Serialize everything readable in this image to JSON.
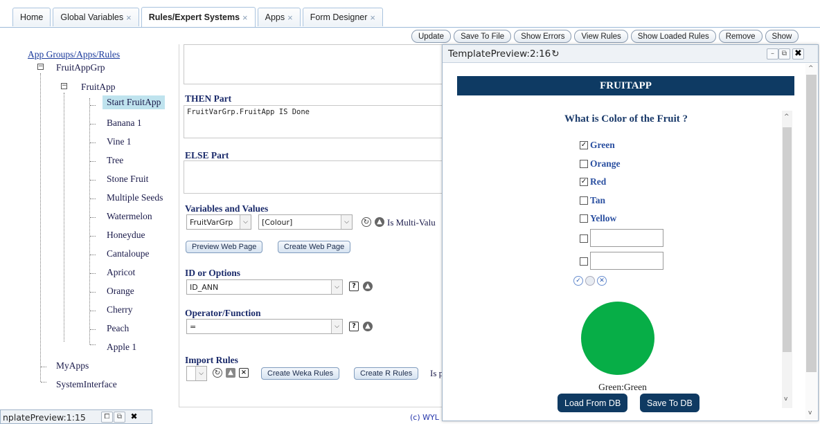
{
  "tabs": [
    {
      "label": "Home",
      "closable": false
    },
    {
      "label": "Global Variables",
      "closable": true
    },
    {
      "label": "Rules/Expert Systems",
      "closable": true
    },
    {
      "label": "Apps",
      "closable": true
    },
    {
      "label": "Form Designer",
      "closable": true
    }
  ],
  "toolbar": [
    "Update",
    "Save To File",
    "Show Errors",
    "View Rules",
    "Show Loaded Rules",
    "Remove",
    "Show"
  ],
  "tree": {
    "root": "App Groups/Apps/Rules",
    "group": "FruitAppGrp",
    "app": "FruitApp",
    "rules": [
      "Start FruitApp",
      "Banana 1",
      "Vine 1",
      "Tree",
      "Stone Fruit",
      "Multiple Seeds",
      "Watermelon",
      "Honeydue",
      "Cantaloupe",
      "Apricot",
      "Orange",
      "Cherry",
      "Peach",
      "Apple 1"
    ],
    "other_groups": [
      "MyApps",
      "SystemInterface"
    ]
  },
  "editor": {
    "then_label": "THEN Part",
    "then_value": "FruitVarGrp.FruitApp IS Done",
    "else_label": "ELSE Part",
    "vars_label": "Variables and Values",
    "var_group": "FruitVarGrp",
    "var_name": "[Colour]",
    "multi_value": "Is Multi-Valu",
    "preview_btn": "Preview Web Page",
    "create_btn": "Create Web Page",
    "id_label": "ID or Options",
    "id_value": "ID_ANN",
    "op_label": "Operator/Function",
    "op_value": "=",
    "import_label": "Import Rules",
    "weka_btn": "Create Weka Rules",
    "r_btn": "Create R Rules",
    "trailing": "Is p"
  },
  "preview": {
    "title": "TemplatePreview:2:16",
    "banner": "FRUITAPP",
    "question": "What is Color of the Fruit ?",
    "options": [
      {
        "label": "Green",
        "checked": true
      },
      {
        "label": "Orange",
        "checked": false
      },
      {
        "label": "Red",
        "checked": true
      },
      {
        "label": "Tan",
        "checked": false
      },
      {
        "label": "Yellow",
        "checked": false
      }
    ],
    "result": "Green:Green",
    "result_color": "#07ae47",
    "load_btn": "Load From DB",
    "save_btn": "Save To DB"
  },
  "bottom": {
    "min_window_title": "nplatePreview:1:15",
    "footer": "(c) WYL"
  }
}
